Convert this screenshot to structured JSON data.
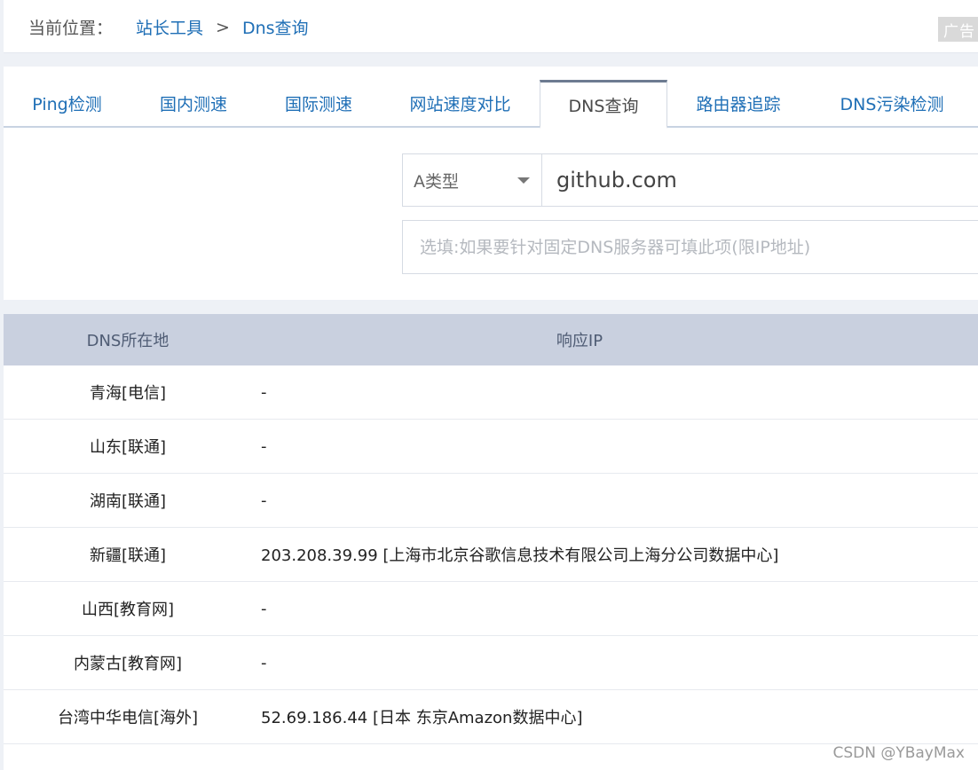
{
  "breadcrumb": {
    "label": "当前位置：",
    "items": [
      "站长工具",
      "Dns查询"
    ],
    "separator": ">"
  },
  "ad_badge": "广告",
  "tabs": [
    {
      "label": "Ping检测",
      "active": false
    },
    {
      "label": "国内测速",
      "active": false
    },
    {
      "label": "国际测速",
      "active": false
    },
    {
      "label": "网站速度对比",
      "active": false
    },
    {
      "label": "DNS查询",
      "active": true
    },
    {
      "label": "路由器追踪",
      "active": false
    },
    {
      "label": "DNS污染检测",
      "active": false
    }
  ],
  "form": {
    "record_type": "A类型",
    "domain_value": "github.com",
    "dns_placeholder": "选填:如果要针对固定DNS服务器可填此项(限IP地址)"
  },
  "table": {
    "headers": [
      "DNS所在地",
      "响应IP"
    ],
    "rows": [
      {
        "location": "青海[电信]",
        "ip": "-"
      },
      {
        "location": "山东[联通]",
        "ip": "-"
      },
      {
        "location": "湖南[联通]",
        "ip": "-"
      },
      {
        "location": "新疆[联通]",
        "ip": "203.208.39.99 [上海市北京谷歌信息技术有限公司上海分公司数据中心]"
      },
      {
        "location": "山西[教育网]",
        "ip": "-"
      },
      {
        "location": "内蒙古[教育网]",
        "ip": "-"
      },
      {
        "location": "台湾中华电信[海外]",
        "ip": "52.69.186.44 [日本 东京Amazon数据中心]"
      }
    ]
  },
  "watermark": "CSDN @YBayMax"
}
